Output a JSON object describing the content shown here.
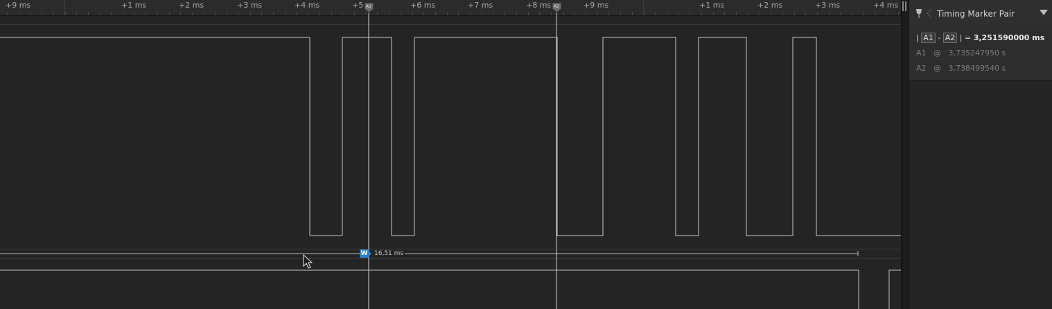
{
  "ruler": {
    "labels": [
      "+9 ms",
      "+1 ms",
      "+2 ms",
      "+3 ms",
      "+4 ms",
      "+5",
      "+6 ms",
      "+7 ms",
      "+8 ms",
      "+9 ms",
      "+1 ms",
      "+2 ms",
      "+3 ms",
      "+4 ms"
    ]
  },
  "markers": {
    "a1_flag": "A1",
    "a2_flag": "A2"
  },
  "width_measure": {
    "badge": "W",
    "value": "16,51 ms"
  },
  "panel": {
    "title": "Timing Marker Pair",
    "diff": {
      "bar_left": "|",
      "a1": "A1",
      "minus": "-",
      "a2": "A2",
      "bar_right": "|",
      "equals": "=",
      "value": "3,251590000 ms"
    },
    "a1_row": {
      "label": "A1",
      "at": "@",
      "value": "3,735247950 s"
    },
    "a2_row": {
      "label": "A2",
      "at": "@",
      "value": "3,738499540 s"
    }
  },
  "colors": {
    "background": "#242424",
    "trace": "#c8c8c8",
    "marker_line": "#cfcfcf",
    "accent_blue": "#2e7fc7"
  },
  "icons": [
    "pin-icon",
    "collapse-caret-icon",
    "menu-caret-icon",
    "marker-flag-icon"
  ]
}
